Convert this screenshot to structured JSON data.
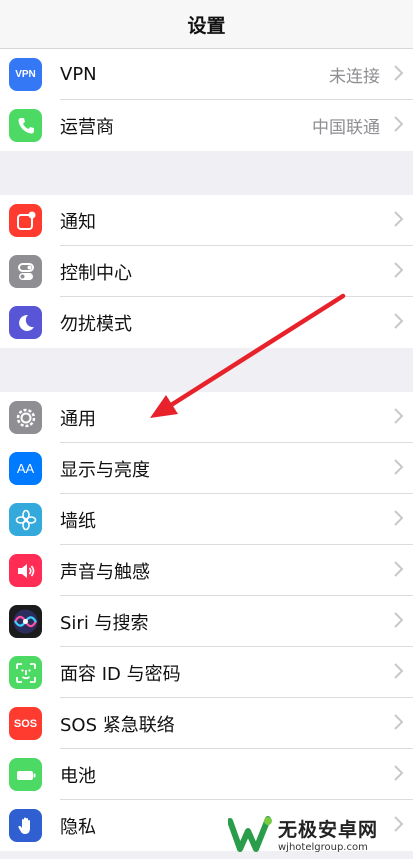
{
  "header": {
    "title": "设置"
  },
  "groups": [
    {
      "items": [
        {
          "icon": "vpn-icon",
          "label": "VPN",
          "value": "未连接",
          "color": "#3478f6"
        },
        {
          "icon": "phone-icon",
          "label": "运营商",
          "value": "中国联通",
          "color": "#4cd964"
        }
      ]
    },
    {
      "items": [
        {
          "icon": "notifications-icon",
          "label": "通知",
          "color": "#ff3b30"
        },
        {
          "icon": "control-center-icon",
          "label": "控制中心",
          "color": "#8e8e93"
        },
        {
          "icon": "moon-icon",
          "label": "勿扰模式",
          "color": "#5856d6"
        }
      ]
    },
    {
      "items": [
        {
          "icon": "gear-icon",
          "label": "通用",
          "color": "#8e8e93"
        },
        {
          "icon": "display-brightness-icon",
          "label": "显示与亮度",
          "color": "#007aff"
        },
        {
          "icon": "wallpaper-flower-icon",
          "label": "墙纸",
          "color": "#34aadc"
        },
        {
          "icon": "speaker-icon",
          "label": "声音与触感",
          "color": "#ff2d55"
        },
        {
          "icon": "siri-icon",
          "label": "Siri 与搜索",
          "color": "#1c1c1e"
        },
        {
          "icon": "face-id-icon",
          "label": "面容 ID 与密码",
          "color": "#4cd964"
        },
        {
          "icon": "sos-icon",
          "label": "SOS 紧急联络",
          "color": "#ff3b30"
        },
        {
          "icon": "battery-icon",
          "label": "电池",
          "color": "#4cd964"
        },
        {
          "icon": "hand-icon",
          "label": "隐私",
          "color": "#2f5fd0"
        }
      ]
    }
  ],
  "icon_text": {
    "vpn": "VPN",
    "aa": "AA",
    "sos": "SOS"
  },
  "annotation": {
    "arrow_color": "#e8222b"
  },
  "watermark": {
    "name": "无极安卓网",
    "url": "wjhotelgroup.com"
  }
}
